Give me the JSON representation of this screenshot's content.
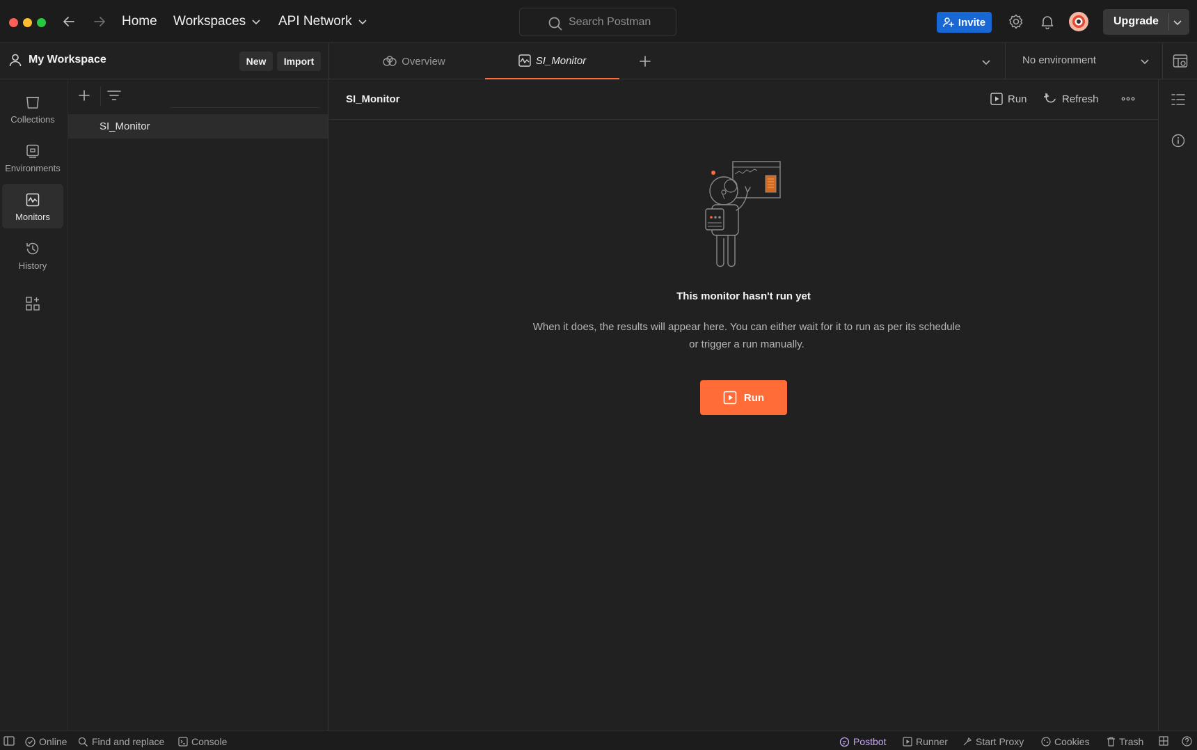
{
  "colors": {
    "accent": "#ff6c37",
    "invite_blue": "#1767d4",
    "bg": "#212121",
    "postbot": "#c7a6ff"
  },
  "titlebar": {
    "home": "Home",
    "workspaces": "Workspaces",
    "api_network": "API Network",
    "search_placeholder": "Search Postman",
    "invite": "Invite",
    "upgrade": "Upgrade"
  },
  "workspace": {
    "name": "My Workspace",
    "new_label": "New",
    "import_label": "Import"
  },
  "tabs": [
    {
      "label": "Overview",
      "icon": "overview-icon",
      "active": false
    },
    {
      "label": "SI_Monitor",
      "icon": "monitor-icon",
      "active": true
    }
  ],
  "environment": {
    "selected": "No environment"
  },
  "rail": [
    {
      "label": "Collections",
      "icon": "collections-icon"
    },
    {
      "label": "Environments",
      "icon": "environments-icon"
    },
    {
      "label": "Monitors",
      "icon": "monitors-icon",
      "active": true
    },
    {
      "label": "History",
      "icon": "history-icon"
    }
  ],
  "sidebar": {
    "items": [
      {
        "label": "SI_Monitor"
      }
    ]
  },
  "main": {
    "title": "SI_Monitor",
    "run": "Run",
    "refresh": "Refresh",
    "empty_title": "This monitor hasn't run yet",
    "empty_desc": "When it does, the results will appear here. You can either wait for it to run as per its schedule or trigger a run manually.",
    "run_button": "Run"
  },
  "status": {
    "online": "Online",
    "find_replace": "Find and replace",
    "console": "Console",
    "postbot": "Postbot",
    "runner": "Runner",
    "start_proxy": "Start Proxy",
    "cookies": "Cookies",
    "trash": "Trash"
  }
}
